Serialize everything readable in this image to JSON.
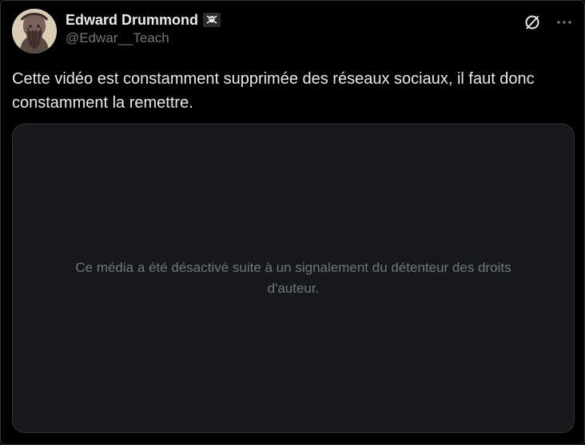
{
  "author": {
    "display_name": "Edward Drummond",
    "name_emoji": "☠",
    "handle": "@Edwar__Teach",
    "avatar_icon": "pirate-portrait"
  },
  "header_actions": {
    "grok_icon": "slashed-circle-icon",
    "more_icon": "more-dots-icon"
  },
  "tweet": {
    "text": "Cette vidéo est constamment supprimée des réseaux sociaux, il faut donc constamment la remettre."
  },
  "media": {
    "disabled_message": "Ce média a été désactivé suite à un signalement du détenteur des droits d'auteur."
  },
  "colors": {
    "background": "#000000",
    "text_primary": "#e7e9ea",
    "text_secondary": "#71767b",
    "media_bg": "#16181c",
    "border": "#2f3336"
  }
}
